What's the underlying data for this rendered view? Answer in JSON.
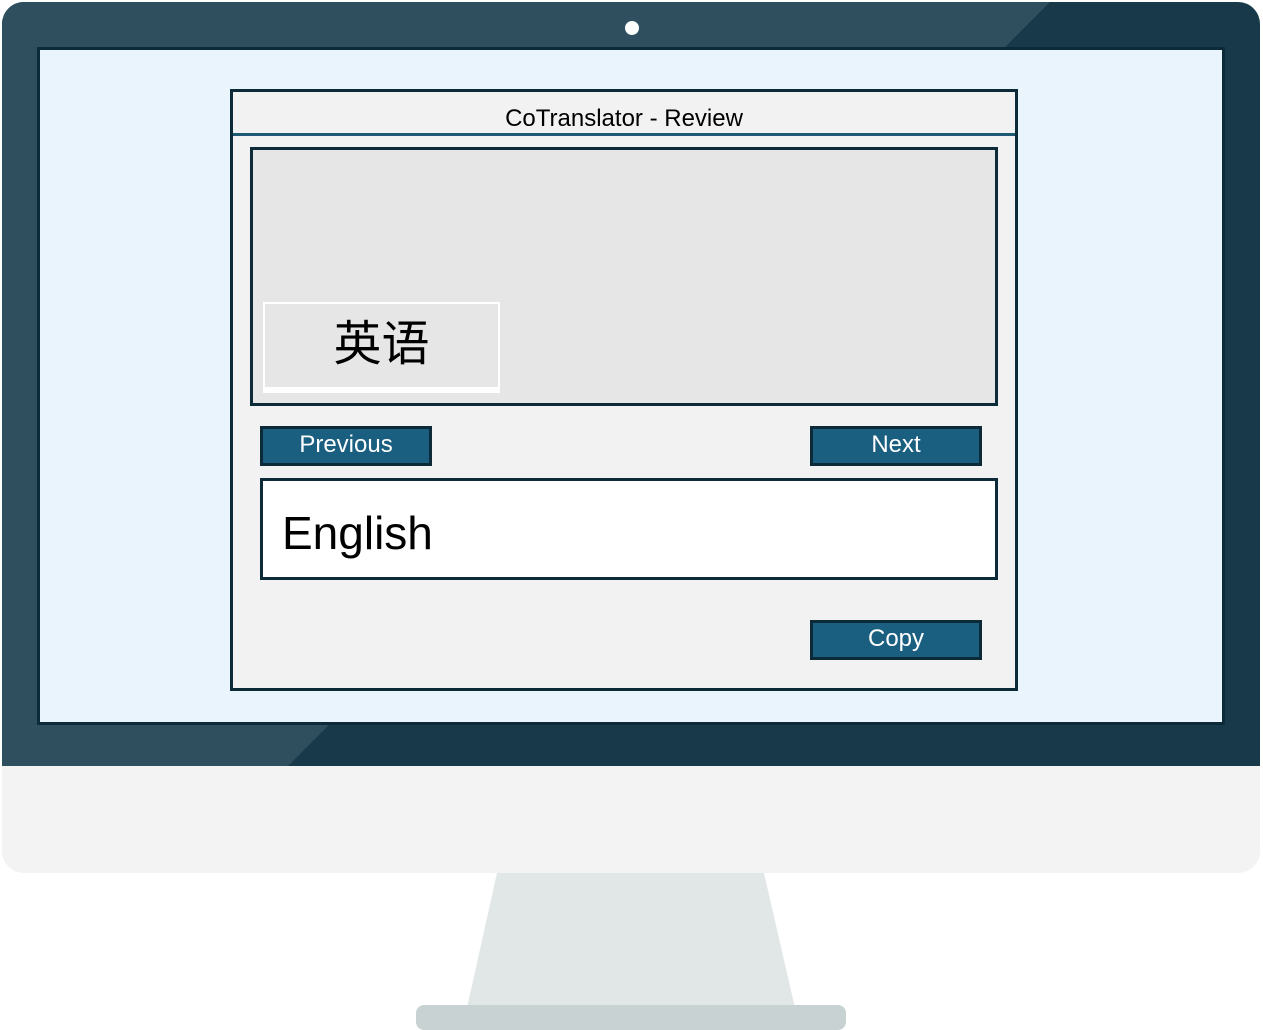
{
  "app": {
    "title": "CoTranslator - Review"
  },
  "source": {
    "term": "英语"
  },
  "navigation": {
    "previous_label": "Previous",
    "next_label": "Next"
  },
  "output": {
    "translation": "English"
  },
  "actions": {
    "copy_label": "Copy"
  },
  "colors": {
    "bezel": "#17394a",
    "bezel_highlight": "#2f4f5e",
    "screen": "#eaf4fc",
    "window": "#f2f2f2",
    "source_panel": "#e6e6e6",
    "button": "#1b5f80",
    "border": "#0d2a38",
    "stand": "#e1e6e6",
    "stand_base": "#c9d2d2",
    "chin": "#f3f3f3"
  }
}
